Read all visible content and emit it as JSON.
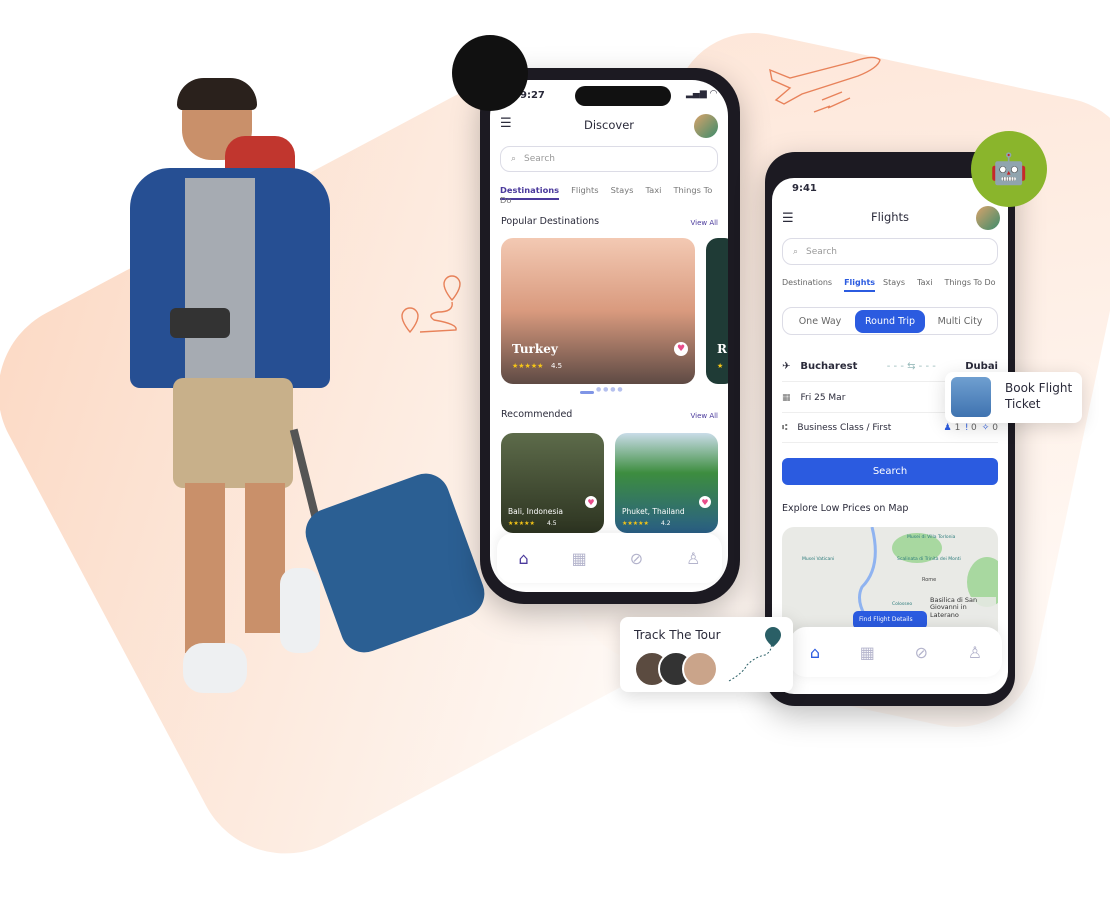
{
  "colors": {
    "accent_ios": "#4b3a9c",
    "accent_android": "#2b5be0",
    "apple_badge": "#111111",
    "android_badge": "#8ab52c",
    "brand_orange": "#e8825a"
  },
  "ios": {
    "time": "9:27",
    "title": "Discover",
    "search_placeholder": "Search",
    "tabs": [
      {
        "label": "Destinations",
        "active": true
      },
      {
        "label": "Flights"
      },
      {
        "label": "Stays"
      },
      {
        "label": "Taxi"
      },
      {
        "label": "Things To Do"
      }
    ],
    "popular": {
      "heading": "Popular Destinations",
      "view_all": "View All",
      "cards": [
        {
          "name": "Turkey",
          "rating": "4.5",
          "stars": "★★★★★"
        },
        {
          "name": "R",
          "rating": "",
          "stars": "★"
        }
      ]
    },
    "recommended": {
      "heading": "Recommended",
      "view_all": "View All",
      "cards": [
        {
          "name": "Bali, Indonesia",
          "rating": "4.5",
          "stars": "★★★★★"
        },
        {
          "name": "Phuket, Thailand",
          "rating": "4.2",
          "stars": "★★★★★"
        }
      ]
    },
    "nav": [
      "home-icon",
      "calendar-icon",
      "compass-icon",
      "user-icon"
    ]
  },
  "android": {
    "time": "9:41",
    "title": "Flights",
    "search_placeholder": "Search",
    "tabs": [
      {
        "label": "Destinations"
      },
      {
        "label": "Flights",
        "active": true
      },
      {
        "label": "Stays"
      },
      {
        "label": "Taxi"
      },
      {
        "label": "Things To Do"
      }
    ],
    "trip_types": [
      {
        "label": "One Way"
      },
      {
        "label": "Round Trip",
        "active": true
      },
      {
        "label": "Multi City"
      }
    ],
    "from": "Bucharest",
    "to": "Dubai",
    "date": "Fri 25 Mar",
    "cabin": "Business Class / First",
    "passengers": {
      "adults": "1",
      "children": "0",
      "infants": "0"
    },
    "search_button": "Search",
    "map_heading": "Explore Low Prices on Map",
    "map_labels": [
      "Musei Vaticani",
      "Musei di Villa Torlonia",
      "Scalinata di Trinità dei Monti",
      "Rome",
      "Colosseo",
      "Basilica di San Giovanni in Laterano"
    ],
    "find_button": "Find Flight Details"
  },
  "book_card": {
    "line1": "Book Flight",
    "line2": "Ticket"
  },
  "track_card": {
    "title": "Track The Tour"
  }
}
